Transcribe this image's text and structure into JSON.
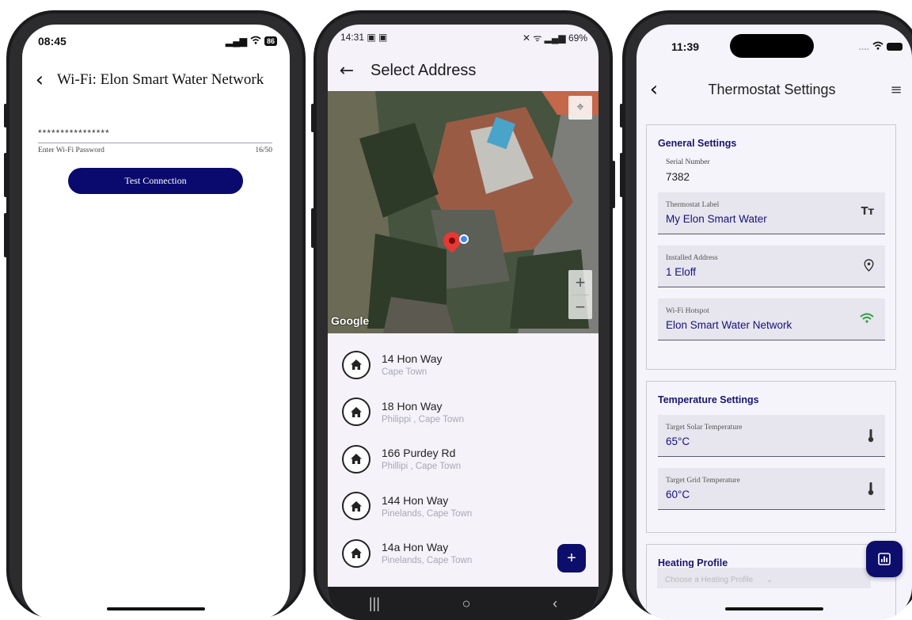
{
  "phone1": {
    "status": {
      "time": "08:45",
      "battery": "86"
    },
    "header": {
      "title": "Wi-Fi: Elon Smart Water Network"
    },
    "password": {
      "value": "****************",
      "helper": "Enter Wi-Fi Password",
      "counter": "16/50"
    },
    "test_button": "Test Connection"
  },
  "phone2": {
    "status": {
      "time": "14:31",
      "right": "69%"
    },
    "header": {
      "title": "Select Address"
    },
    "map": {
      "attribution": "Google"
    },
    "addresses": [
      {
        "street": "14 Hon Way",
        "city": "Cape Town"
      },
      {
        "street": "18 Hon Way",
        "city": "Philippi , Cape Town"
      },
      {
        "street": "166 Purdey Rd",
        "city": "Phillipi , Cape Town"
      },
      {
        "street": "144  Hon Way",
        "city": "Pinelands, Cape Town"
      },
      {
        "street": "14a Hon Way",
        "city": "Pinelands, Cape Town"
      }
    ],
    "add_button": "+"
  },
  "phone3": {
    "status": {
      "time": "11:39"
    },
    "header": {
      "title": "Thermostat Settings"
    },
    "general": {
      "title": "General Settings",
      "serial_label": "Serial Number",
      "serial_value": "7382",
      "fields": [
        {
          "label": "Thermostat Label",
          "value": "My Elon Smart Water",
          "icon": "text-size-icon"
        },
        {
          "label": "Installed Address",
          "value": "1 Eloff",
          "icon": "location-pin-icon"
        },
        {
          "label": "Wi-Fi Hotspot",
          "value": "Elon Smart Water Network",
          "icon": "wifi-icon"
        }
      ]
    },
    "temperature": {
      "title": "Temperature Settings",
      "fields": [
        {
          "label": "Target Solar Temperature",
          "value": "65°C",
          "icon": "thermometer-icon"
        },
        {
          "label": "Target Grid Temperature",
          "value": "60°C",
          "icon": "thermometer-icon"
        }
      ]
    },
    "heating": {
      "title": "Heating Profile",
      "placeholder": "Choose a Heating Profile"
    }
  },
  "colors": {
    "primary": "#0d0d6b",
    "accent_text": "#131380",
    "wifi_green": "#2e9e3e",
    "pin_red": "#e53935"
  }
}
